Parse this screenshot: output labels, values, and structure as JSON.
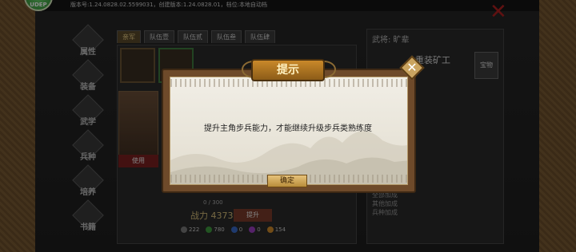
{
  "topbar": {
    "version_text": "版本号:1.24.0828.02.5599031，创建版本:1.24.0828.01，档位:本地自动档",
    "badge_text": "UDEP"
  },
  "menu": {
    "items": [
      {
        "label": "属性"
      },
      {
        "label": "装备"
      },
      {
        "label": "武学"
      },
      {
        "label": "兵种"
      },
      {
        "label": "培养"
      },
      {
        "label": "书籍"
      }
    ]
  },
  "tabs": [
    {
      "label": "亲军",
      "active": true
    },
    {
      "label": "队伍壹",
      "active": false
    },
    {
      "label": "队伍贰",
      "active": false
    },
    {
      "label": "队伍叁",
      "active": false
    },
    {
      "label": "队伍肆",
      "active": false
    }
  ],
  "character": {
    "use_label": "使用",
    "progress": "0 / 300",
    "power_label": "战力 4373",
    "upgrade_label": "提升"
  },
  "resources": [
    {
      "value": "222",
      "color": "#7a7a7a"
    },
    {
      "value": "780",
      "color": "#3f9a3f"
    },
    {
      "value": "0",
      "color": "#3a6ac8"
    },
    {
      "value": "0",
      "color": "#9b3fc0"
    },
    {
      "value": "154",
      "color": "#d08a2a"
    }
  ],
  "info": {
    "title": "武将: 旷辈",
    "equipment": "重装矿工",
    "treasure_label": "宝物",
    "lines": [
      "全部加成",
      "其他加成",
      "兵种加成"
    ]
  },
  "dialog": {
    "title": "提示",
    "message": "提升主角步兵能力，才能继续升级步兵类熟练度",
    "confirm_label": "确定",
    "close_glyph": "✕"
  }
}
